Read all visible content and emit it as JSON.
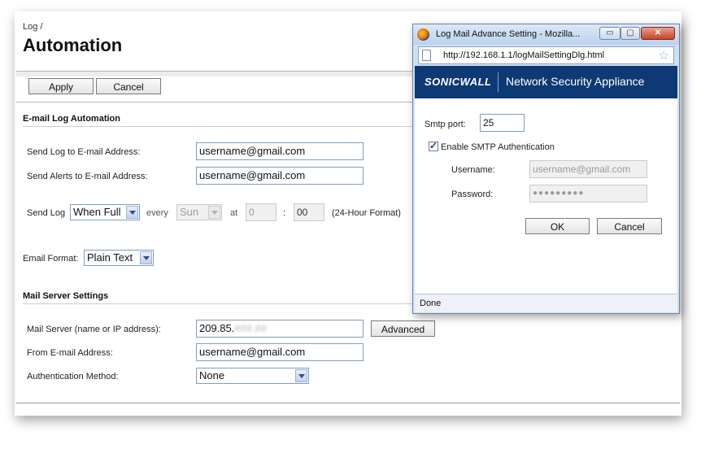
{
  "breadcrumb": "Log /",
  "page_title": "Automation",
  "toolbar": {
    "apply_label": "Apply",
    "cancel_label": "Cancel"
  },
  "email_section": {
    "title": "E-mail Log Automation",
    "send_log_label": "Send Log to E-mail Address:",
    "send_log_value": "username@gmail.com",
    "send_alerts_label": "Send Alerts to E-mail Address:",
    "send_alerts_value": "username@gmail.com",
    "schedule": {
      "label": "Send Log",
      "when_value": "When Full",
      "every_label": "every",
      "day_value": "Sun",
      "at_label": "at",
      "hour_value": "0",
      "colon": ":",
      "minute_value": "00",
      "format_note": "(24-Hour Format)"
    },
    "email_format_label": "Email Format:",
    "email_format_value": "Plain Text"
  },
  "mail_server_section": {
    "title": "Mail Server Settings",
    "mail_server_label": "Mail Server (name or IP address):",
    "mail_server_value": "209.85.",
    "mail_server_redacted": "###.##",
    "advanced_label": "Advanced",
    "from_label": "From E-mail Address:",
    "from_value": "username@gmail.com",
    "auth_label": "Authentication Method:",
    "auth_value": "None"
  },
  "popup": {
    "window_title": "Log Mail Advance Setting - Mozilla...",
    "minimize_label": "▭",
    "maximize_label": "▢",
    "close_label": "✕",
    "url": "http://192.168.1.1/logMailSettingDlg.html",
    "logo_text": "SONICWALL",
    "product_name": "Network Security Appliance",
    "smtp_port_label": "Smtp port:",
    "smtp_port_value": "25",
    "enable_auth_label": "Enable SMTP Authentication",
    "enable_auth_checked": true,
    "username_label": "Username:",
    "username_value": "username@gmail.com",
    "password_label": "Password:",
    "password_value": "●●●●●●●●●",
    "ok_label": "OK",
    "cancel_label": "Cancel",
    "status_text": "Done"
  }
}
